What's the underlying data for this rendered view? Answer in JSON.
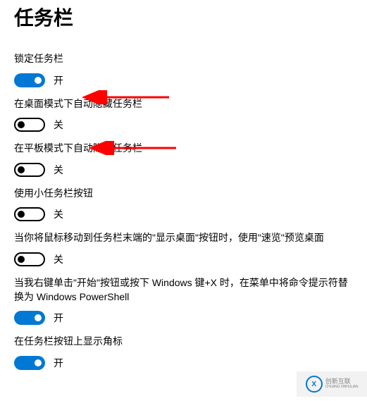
{
  "title": "任务栏",
  "state_on": "开",
  "state_off": "关",
  "settings": [
    {
      "label": "锁定任务栏",
      "on": true
    },
    {
      "label": "在桌面模式下自动隐藏任务栏",
      "on": false
    },
    {
      "label": "在平板模式下自动隐藏任务栏",
      "on": false
    },
    {
      "label": "使用小任务栏按钮",
      "on": false
    },
    {
      "label": "当你将鼠标移动到任务栏末端的\"显示桌面\"按钮时，使用\"速览\"预览桌面",
      "on": false
    },
    {
      "label": "当我右键单击\"开始\"按钮或按下 Windows 键+X 时，在菜单中将命令提示符替换为 Windows PowerShell",
      "on": true
    },
    {
      "label": "在任务栏按钮上显示角标",
      "on": true
    }
  ],
  "arrow_color": "#ff0000",
  "watermark": {
    "line1": "创新互联",
    "line2": "CHUANG XINHULIAN"
  }
}
